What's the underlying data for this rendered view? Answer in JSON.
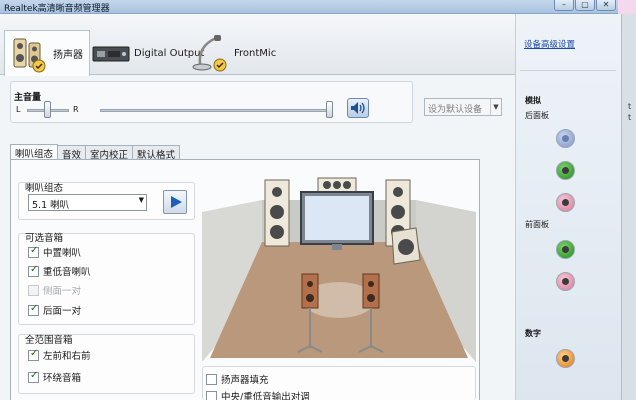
{
  "window": {
    "title": "Realtek高清晰音频管理器",
    "buttons": [
      "–",
      "▢",
      "✕"
    ]
  },
  "device_tabs": [
    {
      "label": "扬声器",
      "icon": "speaker-icon",
      "active": true
    },
    {
      "label": "Digital Output",
      "icon": "digital-output-icon",
      "active": false
    },
    {
      "label": "FrontMic",
      "icon": "microphone-icon",
      "active": false
    }
  ],
  "master_volume": {
    "label": "主音量",
    "left": "L",
    "right": "R",
    "balance_level": 0.5,
    "volume_level": 1.0,
    "default_device_label": "设为默认设备"
  },
  "subtabs": [
    {
      "label": "喇叭组态",
      "active": true
    },
    {
      "label": "音效",
      "active": false
    },
    {
      "label": "室内校正",
      "active": false
    },
    {
      "label": "默认格式",
      "active": false
    }
  ],
  "speaker_config": {
    "group_label": "喇叭组态",
    "selected": "5.1 喇叭"
  },
  "optional_speakers": {
    "group_label": "可选音箱",
    "items": [
      {
        "label": "中置喇叭",
        "checked": true,
        "enabled": true
      },
      {
        "label": "重低音喇叭",
        "checked": true,
        "enabled": true
      },
      {
        "label": "侧面一对",
        "checked": false,
        "enabled": false
      },
      {
        "label": "后面一对",
        "checked": true,
        "enabled": true
      }
    ]
  },
  "fullrange": {
    "group_label": "全范围音箱",
    "items": [
      {
        "label": "左前和右前",
        "checked": true
      },
      {
        "label": "环绕音箱",
        "checked": true
      }
    ]
  },
  "bottom_options": [
    {
      "label": "扬声器填充",
      "checked": false
    },
    {
      "label": "中央/重低音输出对调",
      "checked": false
    }
  ],
  "right_panel": {
    "advanced_link": "设备高级设置",
    "analog_label": "模拟",
    "back_panel_label": "后面板",
    "front_panel_label": "前面板",
    "digital_label": "数字"
  },
  "edge_chars": [
    "t",
    "t"
  ],
  "colors": {
    "jack_blue": "#8aa0d4",
    "jack_green": "#2a9a25",
    "jack_pink": "#e08aa5",
    "jack_orange": "#ee8a1c",
    "floor": "#b9987c"
  }
}
